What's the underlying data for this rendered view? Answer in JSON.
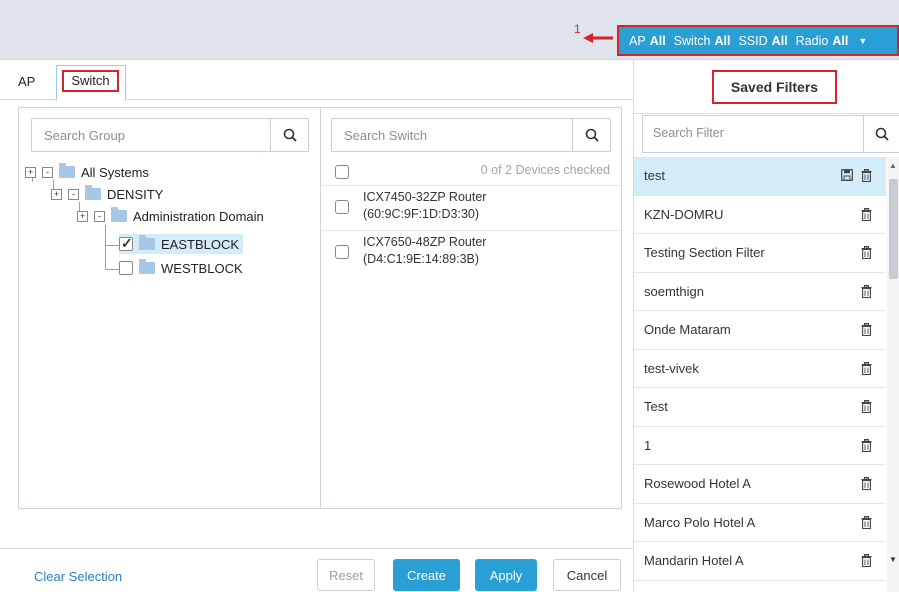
{
  "annotation": {
    "number": "1"
  },
  "filter_bar": {
    "items": [
      {
        "key": "AP",
        "value": "All"
      },
      {
        "key": "Switch",
        "value": "All"
      },
      {
        "key": "SSID",
        "value": "All"
      },
      {
        "key": "Radio",
        "value": "All"
      }
    ],
    "caret_icon": "caret-down-icon"
  },
  "tabs": {
    "ap": "AP",
    "switch": "Switch"
  },
  "group_search": {
    "placeholder": "Search Group",
    "icon": "search-icon"
  },
  "switch_search": {
    "placeholder": "Search Switch",
    "icon": "search-icon"
  },
  "tree": {
    "root": "All Systems",
    "density": "DENSITY",
    "admin_domain": "Administration Domain",
    "eastblock": "EASTBLOCK",
    "westblock": "WESTBLOCK"
  },
  "devices": {
    "count_text": "0 of 2 Devices checked",
    "items": [
      {
        "name": "ICX7450-32ZP Router",
        "mac": "(60:9C:9F:1D:D3:30)"
      },
      {
        "name": "ICX7650-48ZP Router",
        "mac": "(D4:C1:9E:14:89:3B)"
      }
    ]
  },
  "footer": {
    "clear": "Clear Selection",
    "reset": "Reset",
    "create": "Create",
    "apply": "Apply",
    "cancel": "Cancel"
  },
  "saved_filters": {
    "title": "Saved Filters",
    "search_placeholder": "Search Filter",
    "items": [
      "test",
      "KZN-DOMRU",
      "Testing Section Filter",
      "soemthign",
      "Onde Mataram",
      "test-vivek",
      "Test",
      "1",
      "Rosewood Hotel A",
      "Marco Polo Hotel A",
      "Mandarin Hotel A"
    ]
  },
  "colors": {
    "accent": "#2a9fd6",
    "annotation_red": "#d8232a",
    "selected_row": "#d4ecfa",
    "topbar_bg": "#dfe3ea"
  }
}
